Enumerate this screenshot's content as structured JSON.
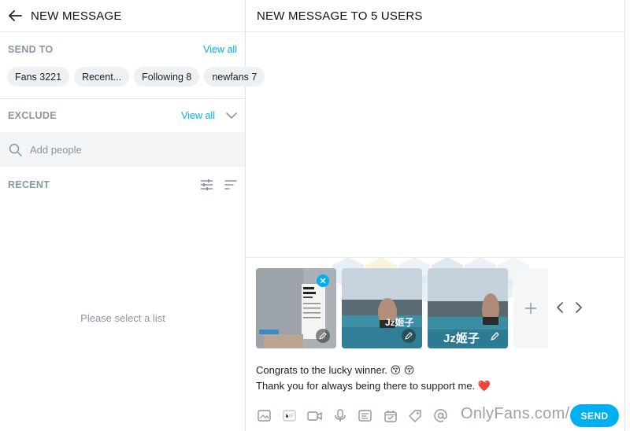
{
  "left_panel": {
    "header": {
      "title": "NEW MESSAGE"
    },
    "send_to": {
      "label": "SEND TO",
      "view_all": "View all",
      "chips": [
        "Fans 3221",
        "Recent...",
        "Following 8",
        "newfans 7"
      ]
    },
    "exclude": {
      "label": "EXCLUDE",
      "view_all": "View all"
    },
    "search": {
      "placeholder": "Add people"
    },
    "recent": {
      "label": "RECENT"
    },
    "empty_text": "Please select a list"
  },
  "right_panel": {
    "header": {
      "title": "NEW MESSAGE TO 5 USERS"
    },
    "message_lines": [
      "Congrats to the lucky winner. 😚 😚",
      "Thank you for always being there to support me. ❤️"
    ],
    "media_overlay_text": [
      "Jz姬子",
      "Jz姬子"
    ],
    "watermark": "OnlyFans.com/ 2",
    "send_label": "SEND"
  },
  "colors": {
    "accent": "#00aff0",
    "muted": "#8a96a3",
    "chip_bg": "#eef1f3",
    "heart": "#e02424"
  }
}
